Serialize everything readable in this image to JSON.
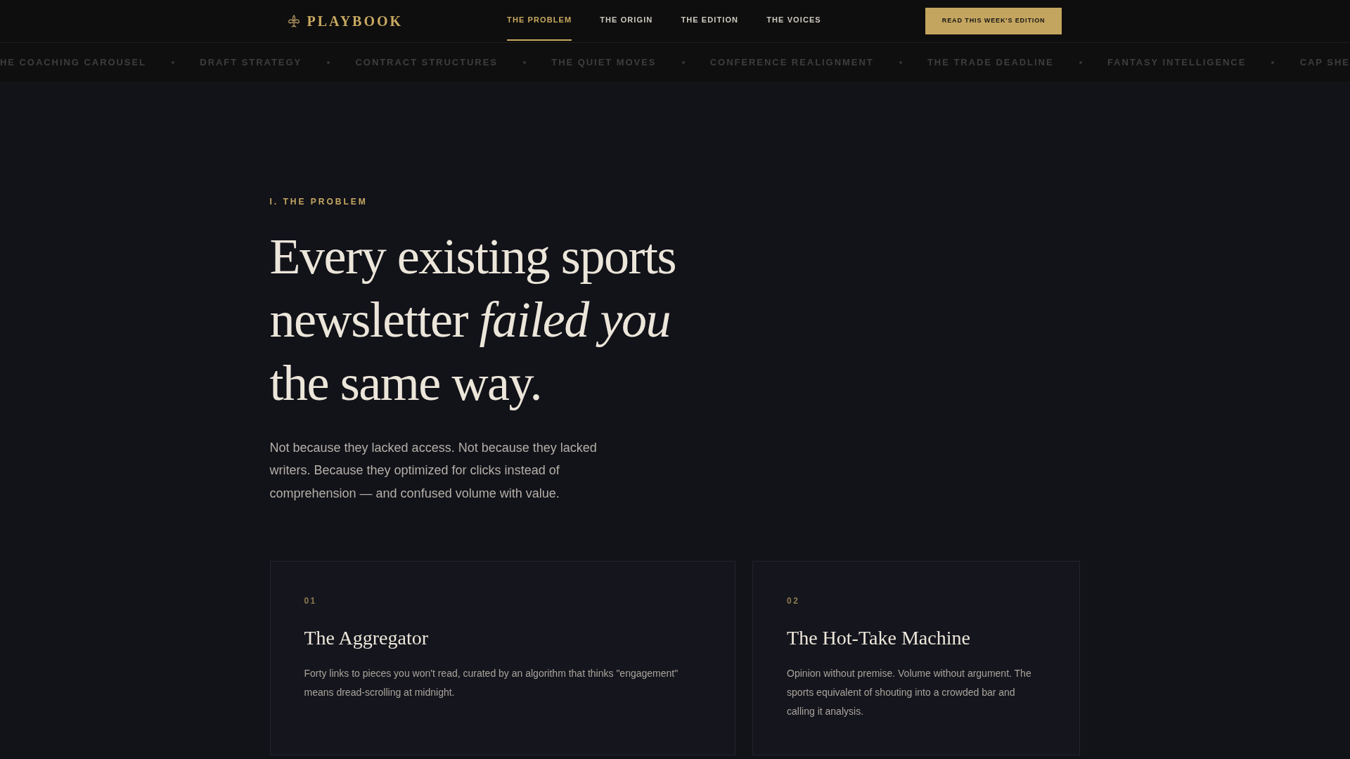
{
  "brand": {
    "name": "PLAYBOOK"
  },
  "nav": {
    "links": [
      {
        "label": "THE PROBLEM",
        "selected": true
      },
      {
        "label": "THE ORIGIN",
        "selected": false
      },
      {
        "label": "THE EDITION",
        "selected": false
      },
      {
        "label": "THE VOICES",
        "selected": false
      }
    ],
    "cta": "READ THIS WEEK'S EDITION"
  },
  "ticker": {
    "items": [
      "HE COACHING CAROUSEL",
      "DRAFT STRATEGY",
      "CONTRACT STRUCTURES",
      "THE QUIET MOVES",
      "CONFERENCE REALIGNMENT",
      "THE TRADE DEADLINE",
      "FANTASY INTELLIGENCE",
      "CAP SHE"
    ]
  },
  "hero": {
    "eyebrow": "I. THE PROBLEM",
    "heading": "Every existing sports newsletter *failed you* the same way.",
    "lede": "Not because they lacked access. Not because they lacked writers. Because they optimized for clicks instead of comprehension — and confused volume with value."
  },
  "cards": [
    {
      "number": "01",
      "title": "The Aggregator",
      "text": "Forty links to pieces you won't read, curated by an algorithm that thinks \"engagement\" means dread-scrolling at midnight."
    },
    {
      "number": "02",
      "title": "The Hot-Take Machine",
      "text": "Opinion without premise. Volume without argument. The sports equivalent of shouting into a crowded bar and calling it analysis."
    }
  ]
}
